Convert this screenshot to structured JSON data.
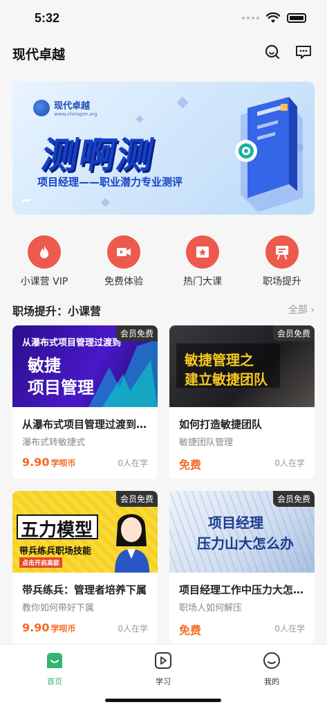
{
  "status": {
    "time": "5:32"
  },
  "header": {
    "title": "现代卓越"
  },
  "banner": {
    "logo_text": "现代卓越",
    "logo_url": "www.chinapm.org",
    "heading": "测啊测",
    "subtitle": "项目经理——职业潜力专业测评"
  },
  "quick": [
    {
      "label": "小课营 VIP",
      "icon": "flame-icon"
    },
    {
      "label": "免费体验",
      "icon": "video-icon"
    },
    {
      "label": "热门大课",
      "icon": "star-board-icon"
    },
    {
      "label": "职场提升",
      "icon": "presentation-icon"
    }
  ],
  "section": {
    "title": "职场提升：小课营",
    "more": "全部 ›"
  },
  "courses": [
    {
      "badge": "会员免费",
      "title": "从瀑布式项目管理过渡到敏捷项目管理",
      "subtitle": "瀑布式转敏捷式",
      "price": "9.90",
      "price_unit": "学呗币",
      "learners": "0人在学",
      "image_lines": [
        "从瀑布式项目管理过渡到",
        "敏捷",
        "项目管理"
      ]
    },
    {
      "badge": "会员免费",
      "title": "如何打造敏捷团队",
      "subtitle": "敏捷团队管理",
      "price": "免费",
      "price_unit": "",
      "learners": "0人在学",
      "image_lines": [
        "敏捷管理之",
        "建立敏捷团队"
      ]
    },
    {
      "badge": "会员免费",
      "title": "带兵练兵：管理者培养下属",
      "subtitle": "教你如何带好下属",
      "price": "9.90",
      "price_unit": "学呗币",
      "learners": "0人在学",
      "image_lines": [
        "五力模型",
        "带兵练兵职场技能",
        "点击开启高能"
      ]
    },
    {
      "badge": "会员免费",
      "title": "项目经理工作中压力大怎么办",
      "subtitle": "职场人如何解压",
      "price": "免费",
      "price_unit": "",
      "learners": "0人在学",
      "image_lines": [
        "项目经理",
        "压力山大怎么办"
      ]
    }
  ],
  "tabs": [
    {
      "label": "首页",
      "icon": "home-icon",
      "active": true
    },
    {
      "label": "学习",
      "icon": "play-icon",
      "active": false
    },
    {
      "label": "我的",
      "icon": "profile-icon",
      "active": false
    }
  ],
  "colors": {
    "accent_green": "#35b46d",
    "price_orange": "#f56a20",
    "icon_red": "#ec5a4d",
    "banner_blue": "#1740c8"
  }
}
